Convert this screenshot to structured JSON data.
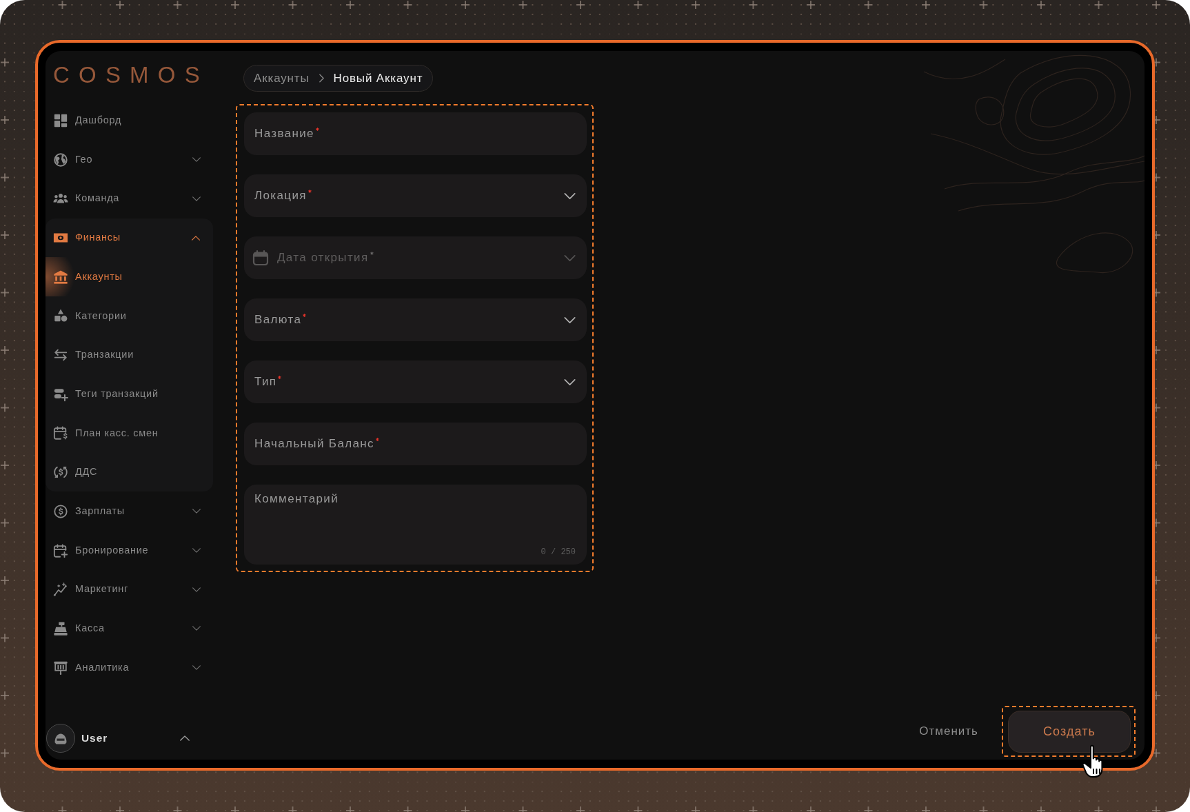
{
  "logo": "COSMOS",
  "sidebar": {
    "items": [
      {
        "kind": "link",
        "label": "Дашборд",
        "selected": false
      },
      {
        "kind": "group",
        "label": "Гео",
        "selected": false,
        "expanded": false
      },
      {
        "kind": "group",
        "label": "Команда",
        "selected": false,
        "expanded": false
      },
      {
        "kind": "group",
        "label": "Финансы",
        "selected": true,
        "expanded": true,
        "children": [
          {
            "label": "Аккаунты",
            "selected": true
          },
          {
            "label": "Категории",
            "selected": false
          },
          {
            "label": "Транзакции",
            "selected": false
          },
          {
            "label": "Теги транзакций",
            "selected": false
          },
          {
            "label": "План касс. смен",
            "selected": false
          },
          {
            "label": "ДДС",
            "selected": false
          }
        ]
      },
      {
        "kind": "group",
        "label": "Зарплаты",
        "selected": false,
        "expanded": false
      },
      {
        "kind": "group",
        "label": "Бронирование",
        "selected": false,
        "expanded": false
      },
      {
        "kind": "group",
        "label": "Маркетинг",
        "selected": false,
        "expanded": false
      },
      {
        "kind": "group",
        "label": "Касса",
        "selected": false,
        "expanded": false
      },
      {
        "kind": "group",
        "label": "Аналитика",
        "selected": false,
        "expanded": false
      }
    ]
  },
  "user": {
    "name": "User"
  },
  "breadcrumb": [
    {
      "label": "Аккаунты",
      "current": false
    },
    {
      "label": "Новый Аккаунт",
      "current": true
    }
  ],
  "form": {
    "highlighted": true,
    "fields": [
      {
        "kind": "text",
        "placeholder": "Название",
        "required": true,
        "disabled": false
      },
      {
        "kind": "select",
        "placeholder": "Локация",
        "required": true,
        "disabled": false
      },
      {
        "kind": "date",
        "placeholder": "Дата открытия",
        "required": true,
        "disabled": true
      },
      {
        "kind": "select",
        "placeholder": "Валюта",
        "required": true,
        "disabled": false
      },
      {
        "kind": "select",
        "placeholder": "Тип",
        "required": true,
        "disabled": false
      },
      {
        "kind": "text",
        "placeholder": "Начальный Баланс",
        "required": true,
        "disabled": false
      },
      {
        "kind": "textarea",
        "placeholder": "Комментарий",
        "required": false,
        "disabled": false,
        "counter": "0 / 250"
      }
    ]
  },
  "actions": [
    {
      "kind": "text",
      "label": "Отменить",
      "highlighted": false
    },
    {
      "kind": "primary",
      "label": "Создать",
      "highlighted": true
    }
  ]
}
